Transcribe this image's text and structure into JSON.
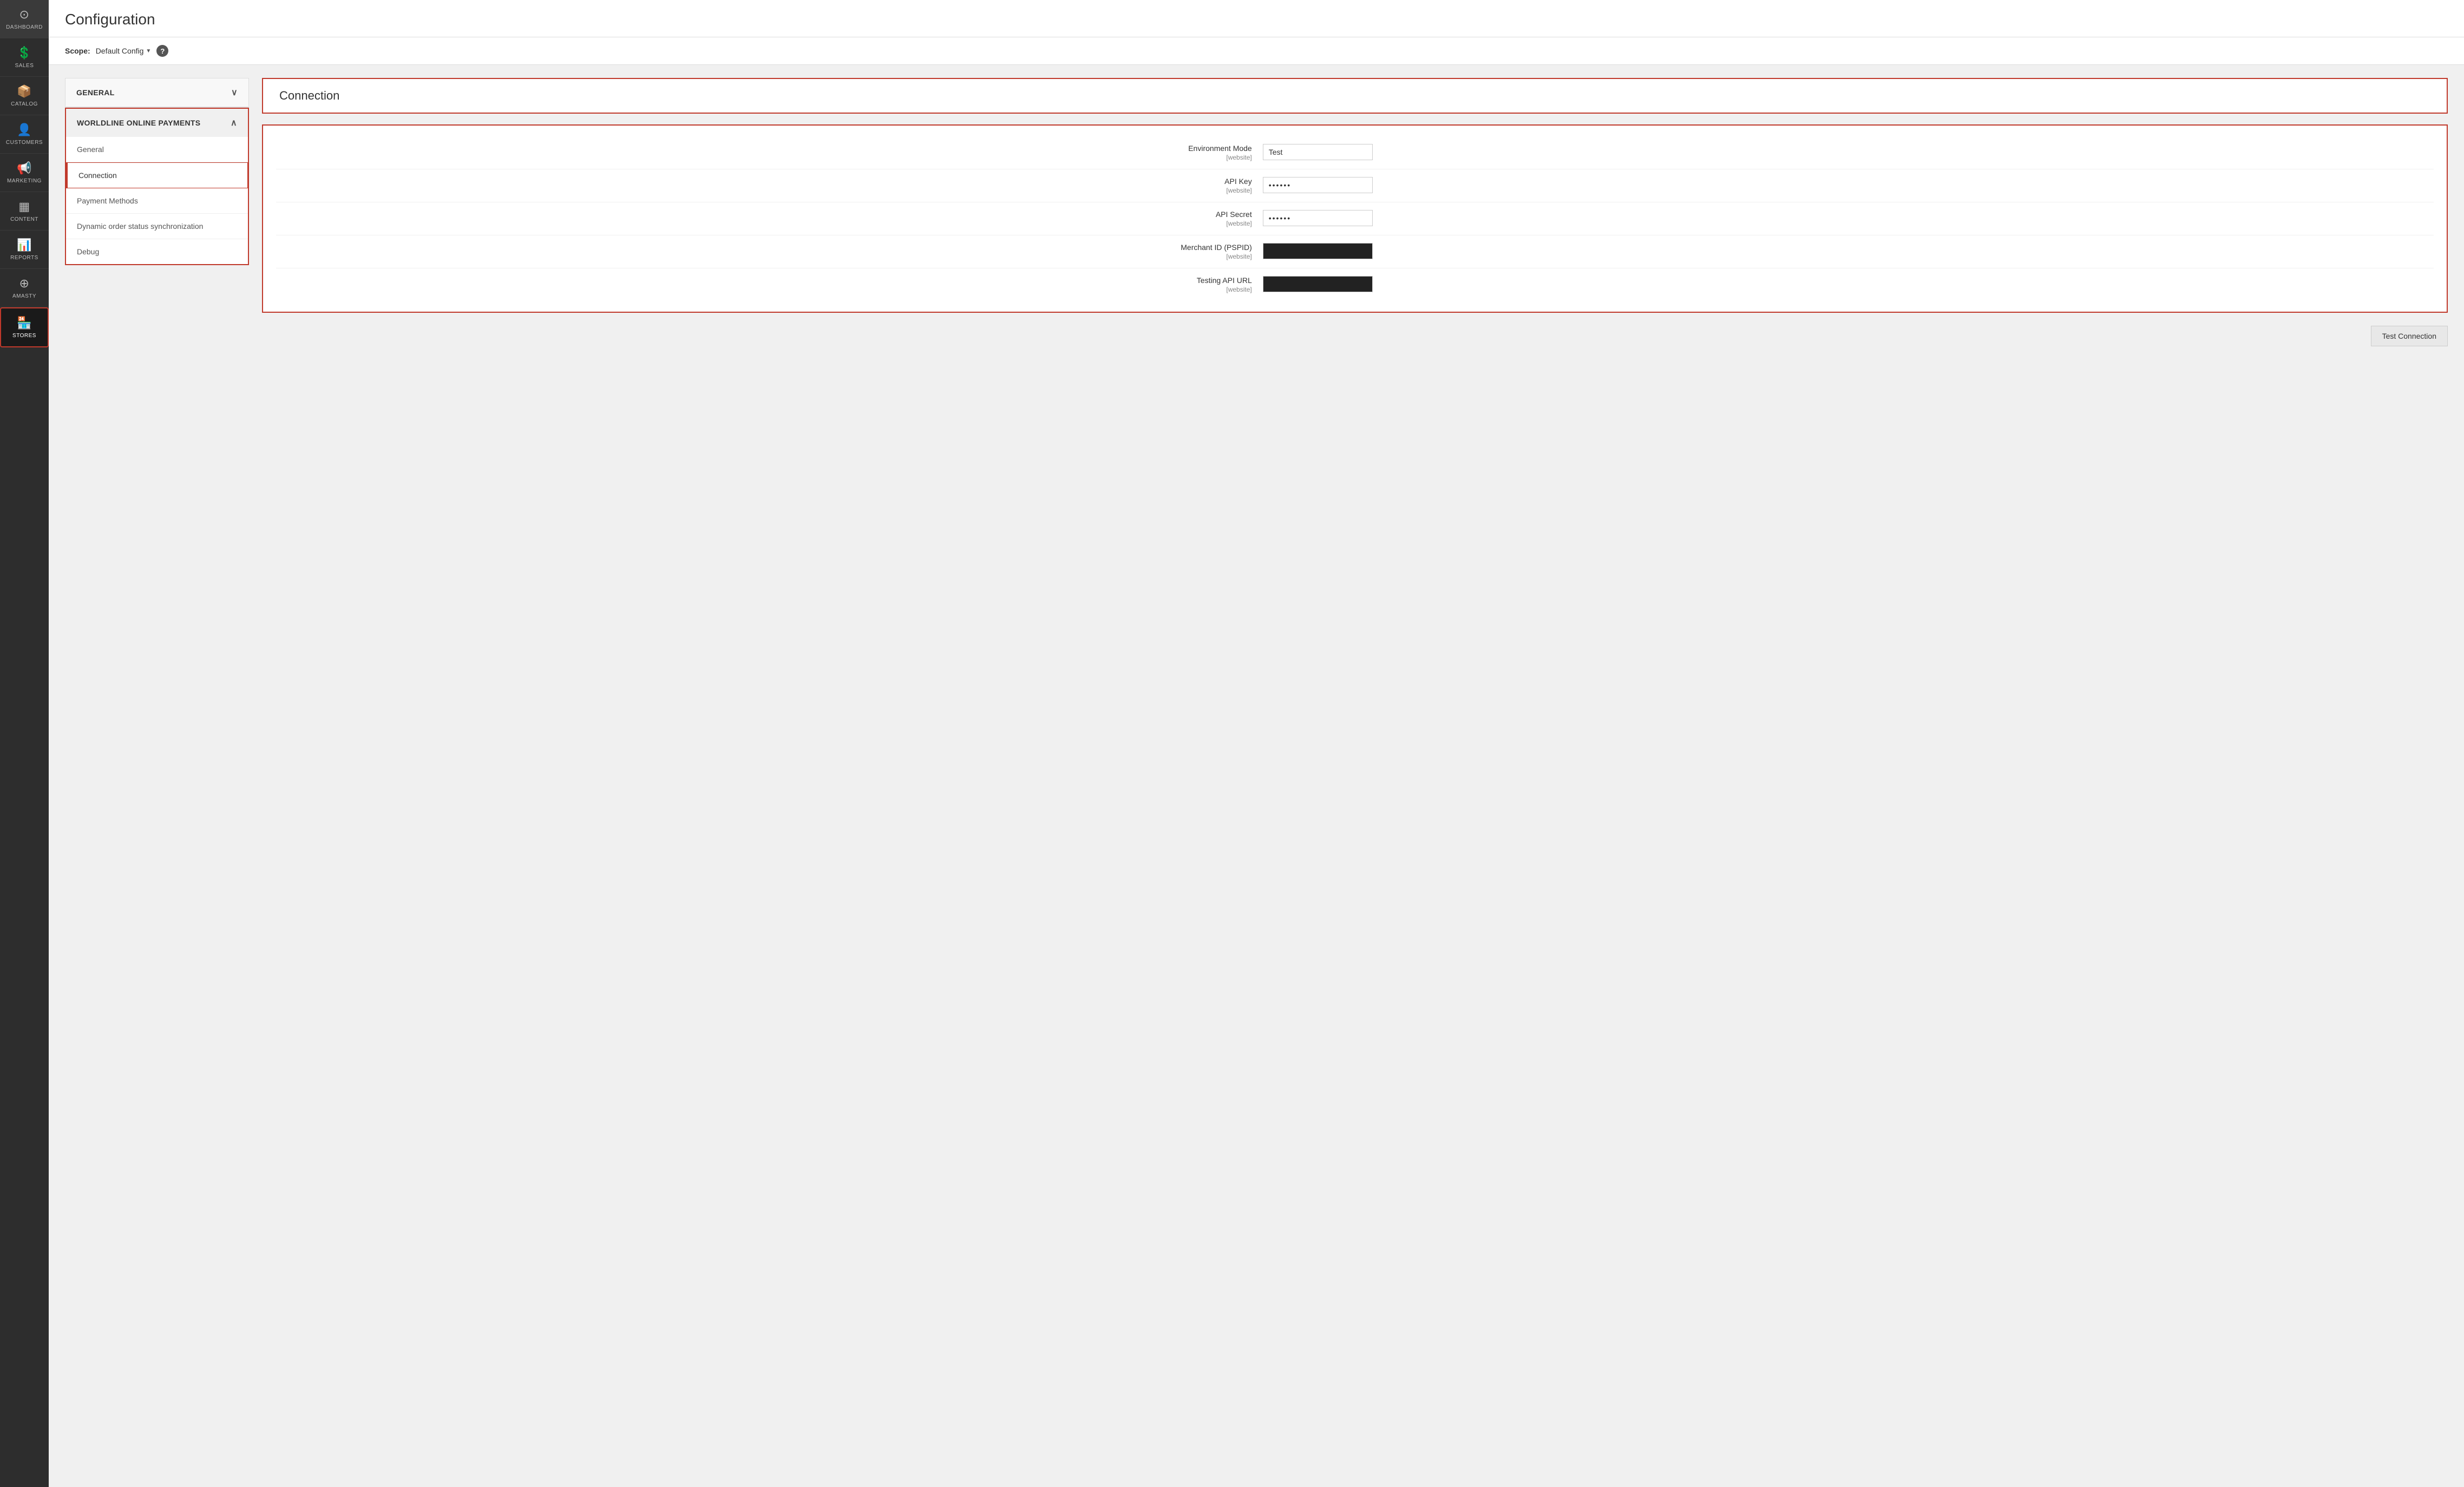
{
  "sidebar": {
    "items": [
      {
        "id": "dashboard",
        "label": "DASHBOARD",
        "icon": "⊙",
        "active": false
      },
      {
        "id": "sales",
        "label": "SALES",
        "icon": "$",
        "active": false
      },
      {
        "id": "catalog",
        "label": "CATALOG",
        "icon": "◫",
        "active": false
      },
      {
        "id": "customers",
        "label": "CUSTOMERS",
        "icon": "👤",
        "active": false
      },
      {
        "id": "marketing",
        "label": "MARKETING",
        "icon": "📢",
        "active": false
      },
      {
        "id": "content",
        "label": "CONTENT",
        "icon": "▦",
        "active": false
      },
      {
        "id": "reports",
        "label": "REPORTS",
        "icon": "▐",
        "active": false
      },
      {
        "id": "amasty",
        "label": "AMASTY",
        "icon": "⊕",
        "active": false
      },
      {
        "id": "stores",
        "label": "STORES",
        "icon": "🏪",
        "active": true
      }
    ]
  },
  "page": {
    "title": "Configuration"
  },
  "scope": {
    "label": "Scope:",
    "value": "Default Config",
    "help_icon": "?"
  },
  "left_nav": {
    "general_section": {
      "label": "GENERAL",
      "expanded": false
    },
    "worldline_section": {
      "label": "WORLDLINE ONLINE PAYMENTS",
      "expanded": true,
      "items": [
        {
          "id": "general",
          "label": "General",
          "active": false
        },
        {
          "id": "connection",
          "label": "Connection",
          "active": true
        },
        {
          "id": "payment-methods",
          "label": "Payment Methods",
          "active": false
        },
        {
          "id": "dynamic-order",
          "label": "Dynamic order status synchronization",
          "active": false
        },
        {
          "id": "debug",
          "label": "Debug",
          "active": false
        }
      ]
    }
  },
  "right_panel": {
    "connection_title": "Connection",
    "config_fields": [
      {
        "id": "environment-mode",
        "label": "Environment Mode",
        "sub": "[website]",
        "value": "Test",
        "type": "text"
      },
      {
        "id": "api-key",
        "label": "API Key",
        "sub": "[website]",
        "value": "••••••",
        "type": "password"
      },
      {
        "id": "api-secret",
        "label": "API Secret",
        "sub": "[website]",
        "value": "••••••",
        "type": "password"
      },
      {
        "id": "merchant-id",
        "label": "Merchant ID (PSPID)",
        "sub": "[website]",
        "value": "",
        "type": "dark"
      },
      {
        "id": "testing-api-url",
        "label": "Testing API URL",
        "sub": "[website]",
        "value": "",
        "type": "dark"
      }
    ],
    "test_btn_label": "Test Connection"
  }
}
